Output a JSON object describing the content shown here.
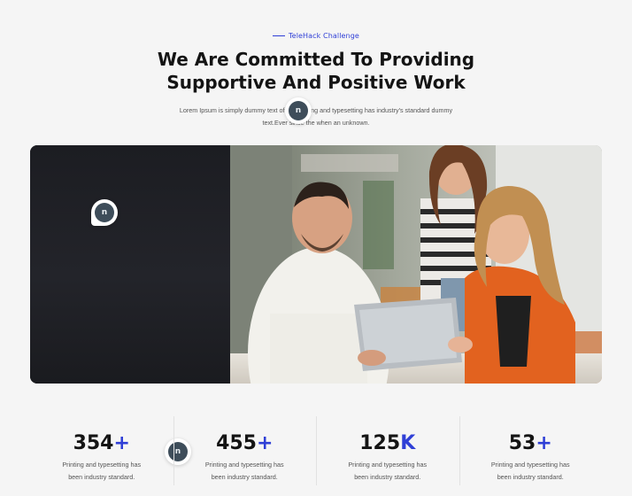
{
  "eyebrow": "TeleHack Challenge",
  "headline": {
    "line1": "We Are Committed To Providing",
    "line2": "Supportive And Positive Work"
  },
  "subtext": {
    "line1": "Lorem Ipsum is simply dummy text of the printing and typesetting has industry's standard dummy",
    "line2": "text.Ever since the when an unknown."
  },
  "badge_letter": "n",
  "stats": [
    {
      "number": "354",
      "suffix": "+",
      "desc1": "Printing and typesetting has",
      "desc2": "been industry standard."
    },
    {
      "number": "455",
      "suffix": "+",
      "desc1": "Printing and typesetting has",
      "desc2": "been industry standard."
    },
    {
      "number": "125",
      "suffix": "K",
      "desc1": "Printing and typesetting has",
      "desc2": "been industry standard."
    },
    {
      "number": "53",
      "suffix": "+",
      "desc1": "Printing and typesetting has",
      "desc2": "been industry standard."
    }
  ],
  "colors": {
    "accent": "#2f3fd6",
    "background": "#f5f5f5",
    "hero_dark": "#1c1d22"
  }
}
